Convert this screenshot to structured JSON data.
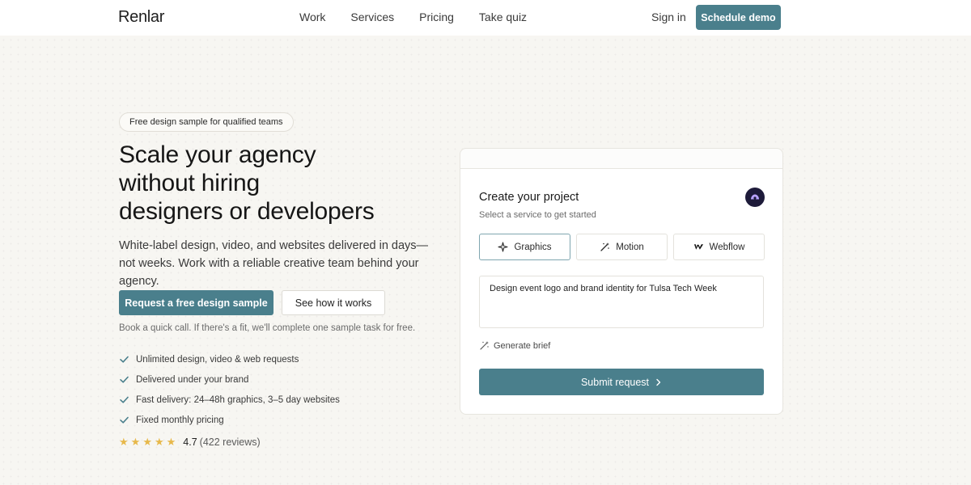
{
  "nav": {
    "logo": "Renlar",
    "links": [
      "Work",
      "Services",
      "Pricing",
      "Take quiz"
    ],
    "sign_in": "Sign in",
    "cta": "Schedule demo"
  },
  "hero": {
    "badge": "Free design sample for qualified teams",
    "headline": [
      "Scale your agency",
      "without hiring",
      "designers or developers"
    ],
    "subtext": "White-label design, video, and websites delivered in days—not weeks. Work with a reliable creative team behind your agency.",
    "primary_cta": "Request a free design sample",
    "secondary_cta": "See how it works",
    "note": "Book a quick call. If there's a fit, we'll complete one sample task for free.",
    "features": [
      "Unlimited design, video & web requests",
      "Delivered under your brand",
      "Fast delivery: 24–48h graphics, 3–5 day websites",
      "Fixed monthly pricing"
    ],
    "rating": {
      "score": "4.7",
      "count": "(422 reviews)",
      "stars": 5
    }
  },
  "card": {
    "title": "Create your project",
    "subtitle": "Select a service to get started",
    "tabs": [
      {
        "label": "Graphics",
        "icon": "sparkle-icon",
        "active": true
      },
      {
        "label": "Motion",
        "icon": "magic-wand-icon",
        "active": false
      },
      {
        "label": "Webflow",
        "icon": "webflow-icon",
        "active": false
      }
    ],
    "request_text": "Design event logo and brand identity for Tulsa Tech Week",
    "generate_brief": "Generate brief",
    "submit": "Submit request"
  },
  "colors": {
    "accent": "#4a7f8c",
    "star": "#e7b84a",
    "background": "#f7f6f2"
  }
}
